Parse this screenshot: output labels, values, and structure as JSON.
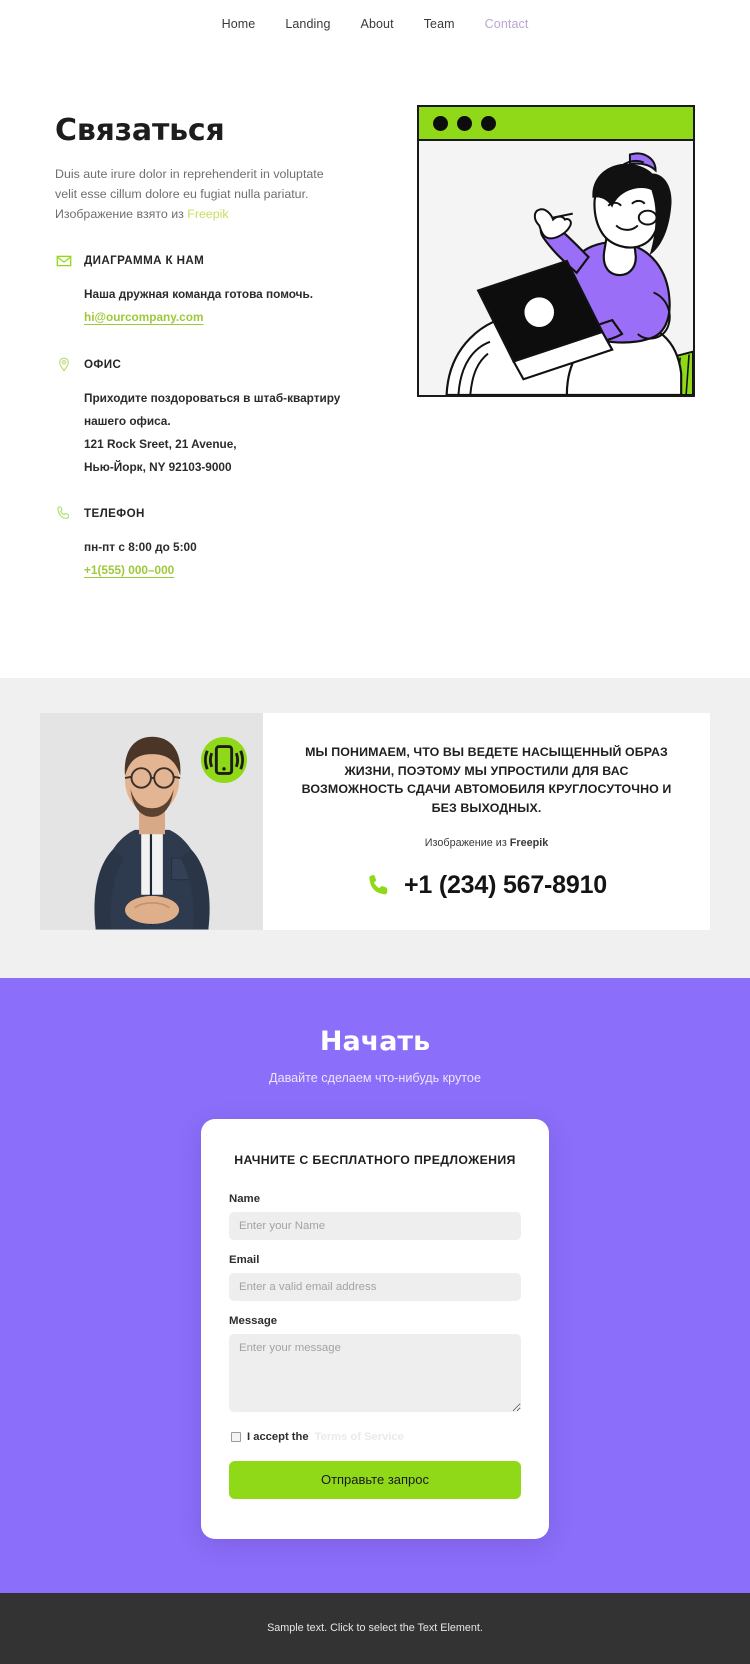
{
  "nav": {
    "items": [
      {
        "label": "Home",
        "active": false
      },
      {
        "label": "Landing",
        "active": false
      },
      {
        "label": "About",
        "active": false
      },
      {
        "label": "Team",
        "active": false
      },
      {
        "label": "Contact",
        "active": true
      }
    ]
  },
  "hero": {
    "title": "Связаться",
    "description": "Duis aute irure dolor in reprehenderit in voluptate velit esse cillum dolore eu fugiat nulla pariatur. Изображение взято из ",
    "description_link": "Freepik",
    "blocks": [
      {
        "icon": "envelope-icon",
        "label": "ДИАГРАММА К НАМ",
        "lines": [
          "Наша дружная команда готова помочь."
        ],
        "link": "hi@ourcompany.com"
      },
      {
        "icon": "map-pin-icon",
        "label": "ОФИС",
        "lines": [
          "Приходите поздороваться в штаб-квартиру",
          "нашего офиса.",
          "121 Rock Sreet, 21 Avenue,",
          "Нью-Йорк, NY 92103-9000"
        ],
        "link": ""
      },
      {
        "icon": "phone-icon",
        "label": "ТЕЛЕФОН",
        "lines": [
          "пн-пт с 8:00 до 5:00"
        ],
        "link": "+1(555) 000–000"
      }
    ],
    "illustration": {
      "name": "woman-with-laptop-illustration",
      "browser_dots": 3
    }
  },
  "promo": {
    "photo_name": "man-in-glasses-photo",
    "badge_icon": "ringing-phone-icon",
    "headline": "МЫ ПОНИМАЕМ, ЧТО ВЫ ВЕДЕТЕ НАСЫЩЕННЫЙ ОБРАЗ ЖИЗНИ, ПОЭТОМУ МЫ УПРОСТИЛИ ДЛЯ ВАС ВОЗМОЖНОСТЬ СДАЧИ АВТОМОБИЛЯ КРУГЛОСУТОЧНО И БЕЗ ВЫХОДНЫХ.",
    "credit_prefix": "Изображение из ",
    "credit_source": "Freepik",
    "phone": "+1 (234) 567-8910",
    "phone_icon": "phone-icon"
  },
  "cta": {
    "title": "Начать",
    "subtitle": "Давайте сделаем что-нибудь крутое",
    "form": {
      "title": "НАЧНИТЕ С БЕСПЛАТНОГО ПРЕДЛОЖЕНИЯ",
      "name_label": "Name",
      "name_placeholder": "Enter your Name",
      "name_value": "",
      "email_label": "Email",
      "email_placeholder": "Enter a valid email address",
      "email_value": "",
      "message_label": "Message",
      "message_placeholder": "Enter your message",
      "message_value": "",
      "accept_text": "I accept the",
      "terms_link": "Terms of Service",
      "submit_label": "Отправьте запрос"
    }
  },
  "footer": {
    "text": "Sample text. Click to select the Text Element."
  },
  "colors": {
    "purple": "#8b6ef9",
    "green": "#8fd918",
    "link_green": "#9ec93a",
    "lime_link": "#c9dc5f",
    "grey_band": "#f0f0f0",
    "footer": "#333333",
    "nav_active": "#b9a7cf"
  }
}
